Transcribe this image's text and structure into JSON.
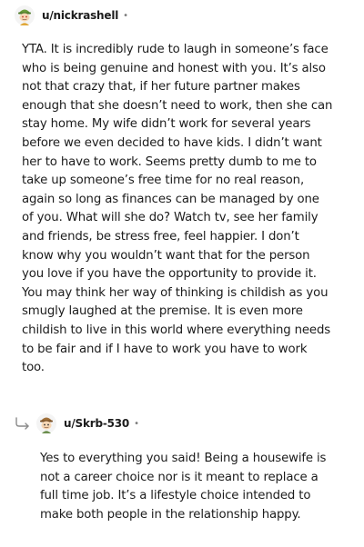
{
  "comment": {
    "username": "u/nickrashell",
    "separator": "•",
    "avatar_icon": "snoo-avatar-green-hat",
    "body": "YTA. It is incredibly rude to laugh in someone’s face\nwho is being genuine and honest with you. It’s also\nnot that crazy that, if her future partner makes\nenough that she doesn’t need to work, then she can\nstay home. My wife didn’t work for several years\nbefore we even decided to have kids. I didn’t want\nher to have to work. Seems pretty dumb to me to\ntake up someone’s free time for no real reason,\nagain so long as finances can be managed by one\nof you. What will she do? Watch tv, see her family\nand friends, be stress free, feel happier. I don’t\nknow why you wouldn’t want that for the person\nyou love if you have the opportunity to provide it.\nYou may think her way of thinking is childish as you\nsmugly laughed at the premise. It is even more\nchildish to live in this world where everything needs\nto be fair and if I have to work you have to work\ntoo."
  },
  "reply": {
    "username": "u/Skrb-530",
    "separator": "•",
    "avatar_icon": "snoo-avatar-brown-hat",
    "reply_icon": "reply-arrow-icon",
    "body": "Yes to everything you said! Being a housewife is\nnot a career choice nor is it meant to replace a\nfull time job. It’s a lifestyle choice intended to\nmake both people in the relationship happy."
  }
}
